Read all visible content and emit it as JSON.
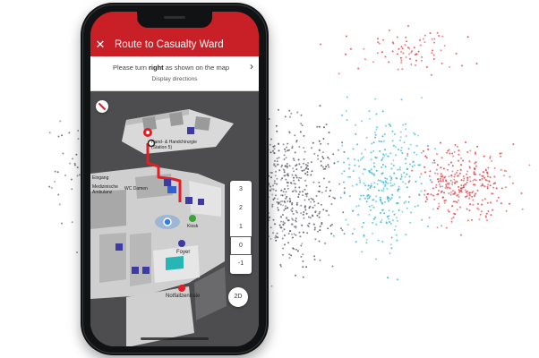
{
  "header": {
    "title": "Route to Casualty Ward",
    "close_icon": "close-icon"
  },
  "direction": {
    "instruction_prefix": "Please turn ",
    "instruction_bold": "right",
    "instruction_suffix": " as shown on the map",
    "display_link": "Display directions",
    "chevron_icon": "chevron-right-icon"
  },
  "map": {
    "labels": {
      "top": "Hand- & Handchirurgie\n(Station 5)",
      "left1": "Eingang",
      "left2": "Medizinische\nAmbulanz",
      "wc": "WC Damen",
      "kiosk": "Kiosk",
      "foyer": "Foyer",
      "emergency": "Notfallzentrale"
    }
  },
  "floors": [
    "3",
    "2",
    "1",
    "0",
    "-1"
  ],
  "active_floor": "0",
  "view_toggle": "2D",
  "colors": {
    "accent": "#c91f26",
    "route": "#e31e24",
    "location": "#2f7de1"
  }
}
